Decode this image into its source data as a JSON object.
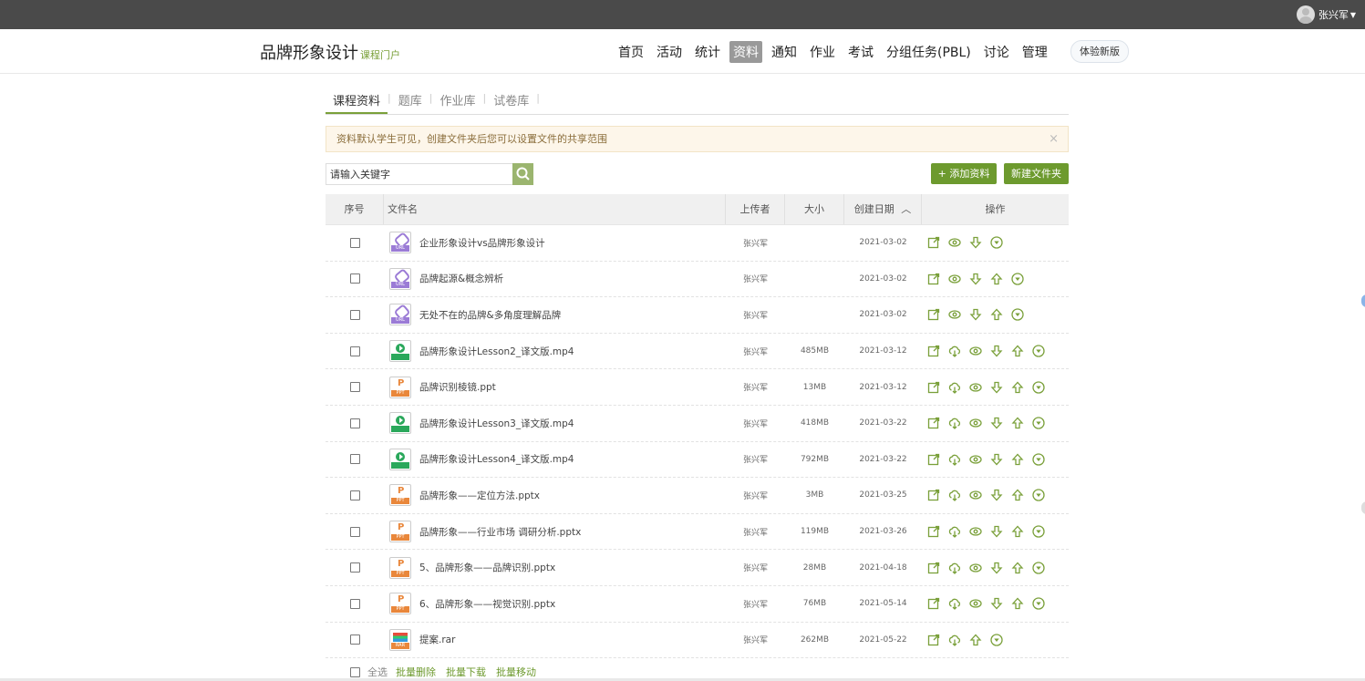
{
  "user": {
    "name": "张兴军"
  },
  "course": {
    "title": "品牌形象设计",
    "portal": "课程门户"
  },
  "nav": [
    "首页",
    "活动",
    "统计",
    "资料",
    "通知",
    "作业",
    "考试",
    "分组任务(PBL)",
    "讨论",
    "管理"
  ],
  "nav_active": "资料",
  "try_new": "体验新版",
  "subtabs": [
    "课程资料",
    "题库",
    "作业库",
    "试卷库"
  ],
  "notice": "资料默认学生可见，创建文件夹后您可以设置文件的共享范围",
  "search": {
    "placeholder": "请输入关键字"
  },
  "buttons": {
    "add": "+ 添加资料",
    "new_folder": "新建文件夹"
  },
  "columns": [
    "序号",
    "文件名",
    "上传者",
    "大小",
    "创建日期",
    "操作"
  ],
  "rows": [
    {
      "type": "url",
      "name": "企业形象设计vs品牌形象设计",
      "uploader": "张兴军",
      "size": "",
      "date": "2021-03-02",
      "ops": [
        "open",
        "view",
        "download",
        "more"
      ]
    },
    {
      "type": "url",
      "name": "品牌起源&概念辨析",
      "uploader": "张兴军",
      "size": "",
      "date": "2021-03-02",
      "ops": [
        "open",
        "view",
        "download",
        "upload",
        "more"
      ]
    },
    {
      "type": "url",
      "name": "无处不在的品牌&多角度理解品牌",
      "uploader": "张兴军",
      "size": "",
      "date": "2021-03-02",
      "ops": [
        "open",
        "view",
        "download",
        "upload",
        "more"
      ]
    },
    {
      "type": "mp4",
      "name": "品牌形象设计Lesson2_译文版.mp4",
      "uploader": "张兴军",
      "size": "485MB",
      "date": "2021-03-12",
      "ops": [
        "open",
        "cloud",
        "view",
        "download",
        "upload",
        "more"
      ]
    },
    {
      "type": "ppt",
      "name": "品牌识别棱镜.ppt",
      "uploader": "张兴军",
      "size": "13MB",
      "date": "2021-03-12",
      "ops": [
        "open",
        "cloud",
        "view",
        "download",
        "upload",
        "more"
      ]
    },
    {
      "type": "mp4",
      "name": "品牌形象设计Lesson3_译文版.mp4",
      "uploader": "张兴军",
      "size": "418MB",
      "date": "2021-03-22",
      "ops": [
        "open",
        "cloud",
        "view",
        "download",
        "upload",
        "more"
      ]
    },
    {
      "type": "mp4",
      "name": "品牌形象设计Lesson4_译文版.mp4",
      "uploader": "张兴军",
      "size": "792MB",
      "date": "2021-03-22",
      "ops": [
        "open",
        "cloud",
        "view",
        "download",
        "upload",
        "more"
      ]
    },
    {
      "type": "ppt",
      "name": "品牌形象——定位方法.pptx",
      "uploader": "张兴军",
      "size": "3MB",
      "date": "2021-03-25",
      "ops": [
        "open",
        "cloud",
        "view",
        "download",
        "upload",
        "more"
      ]
    },
    {
      "type": "ppt",
      "name": "品牌形象——行业市场 调研分析.pptx",
      "uploader": "张兴军",
      "size": "119MB",
      "date": "2021-03-26",
      "ops": [
        "open",
        "cloud",
        "view",
        "download",
        "upload",
        "more"
      ]
    },
    {
      "type": "ppt",
      "name": "5、品牌形象——品牌识别.pptx",
      "uploader": "张兴军",
      "size": "28MB",
      "date": "2021-04-18",
      "ops": [
        "open",
        "cloud",
        "view",
        "download",
        "upload",
        "more"
      ]
    },
    {
      "type": "ppt",
      "name": "6、品牌形象——视觉识别.pptx",
      "uploader": "张兴军",
      "size": "76MB",
      "date": "2021-05-14",
      "ops": [
        "open",
        "cloud",
        "view",
        "download",
        "upload",
        "more"
      ]
    },
    {
      "type": "rar",
      "name": "提案.rar",
      "uploader": "张兴军",
      "size": "262MB",
      "date": "2021-05-22",
      "ops": [
        "open",
        "cloud",
        "upload",
        "more"
      ]
    }
  ],
  "file_tags": {
    "url": "URL",
    "mp4": "",
    "ppt": "PPT",
    "rar": "RAR"
  },
  "footer": {
    "select_all": "全选",
    "batch_delete": "批量删除",
    "batch_download": "批量下载",
    "batch_move": "批量移动"
  },
  "colors": {
    "accent": "#6d9a2e",
    "topbar": "#4a4a4a"
  }
}
